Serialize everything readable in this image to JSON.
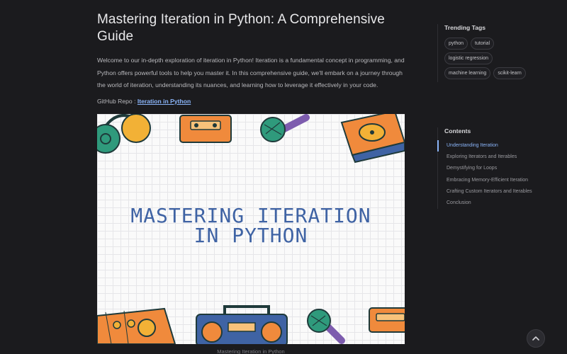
{
  "article": {
    "title": "Mastering Iteration in Python: A Comprehensive Guide",
    "intro": "Welcome to our in-depth exploration of iteration in Python! Iteration is a fundamental concept in programming, and Python offers powerful tools to help you master it. In this comprehensive guide, we'll embark on a journey through the world of iteration, understanding its nuances, and learning how to leverage it effectively in your code.",
    "repo_prefix": "GitHub Repo : ",
    "repo_link_label": "Iteration in Python",
    "hero_title_line1": "MASTERING ITERATION",
    "hero_title_line2": "IN PYTHON",
    "caption": "Mastering Iteration in Python"
  },
  "sidebar": {
    "tags_heading": "Trending Tags",
    "tags": [
      "python",
      "tutorial",
      "logistic regression",
      "machine learning",
      "scikit-learn"
    ],
    "contents_heading": "Contents",
    "toc": [
      "Understanding Iteration",
      "Exploring Iterators and Iterables",
      "Demystifying for Loops",
      "Embracing Memory-Efficient Iteration",
      "Crafting Custom Iterators and Iterables",
      "Conclusion"
    ],
    "active_toc_index": 0
  },
  "colors": {
    "background": "#1b1b1e",
    "link": "#8ab4f8",
    "hero_title": "#3f63a4"
  },
  "icons": {
    "scroll_top": "chevron-up-icon"
  }
}
